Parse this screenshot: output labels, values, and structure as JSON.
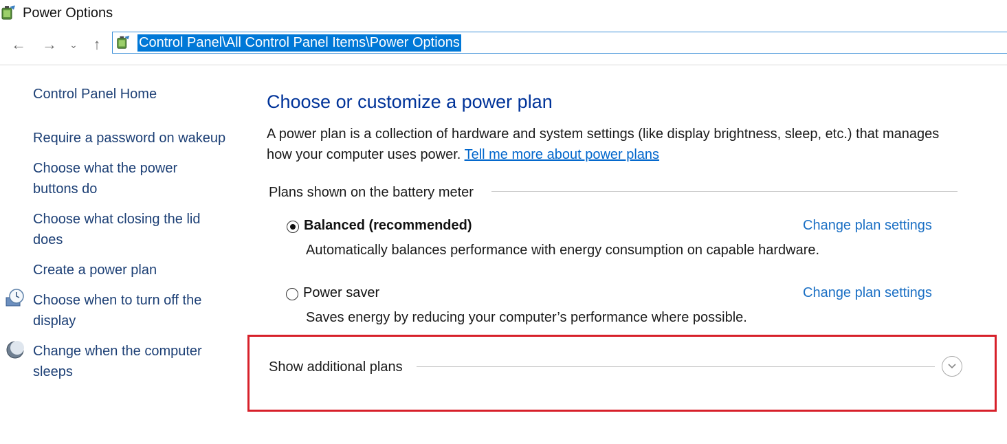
{
  "window": {
    "title": "Power Options"
  },
  "nav": {
    "back_label": "←",
    "forward_label": "→",
    "recent_label": "⌄",
    "up_label": "↑",
    "address": "Control Panel\\All Control Panel Items\\Power Options"
  },
  "sidebar": {
    "home": "Control Panel Home",
    "items": [
      {
        "label": "Require a password on wakeup",
        "icon": ""
      },
      {
        "label": "Choose what the power buttons do",
        "icon": ""
      },
      {
        "label": "Choose what closing the lid does",
        "icon": ""
      },
      {
        "label": "Create a power plan",
        "icon": ""
      },
      {
        "label": "Choose when to turn off the display",
        "icon": "display-clock-icon"
      },
      {
        "label": "Change when the computer sleeps",
        "icon": "moon-icon"
      }
    ]
  },
  "main": {
    "heading": "Choose or customize a power plan",
    "description": "A power plan is a collection of hardware and system settings (like display brightness, sleep, etc.) that manages how your computer uses power.",
    "more_link": "Tell me more about power plans",
    "battery_section_label": "Plans shown on the battery meter",
    "plans": [
      {
        "name": "Balanced (recommended)",
        "description": "Automatically balances performance with energy consumption on capable hardware.",
        "selected": true,
        "change_link": "Change plan settings"
      },
      {
        "name": "Power saver",
        "description": "Saves energy by reducing your computer’s performance where possible.",
        "selected": false,
        "change_link": "Change plan settings"
      }
    ],
    "additional_plans_label": "Show additional plans"
  },
  "colors": {
    "heading": "#003399",
    "link": "#1a6fc4",
    "address_highlight": "#0078d7",
    "annotation_box": "#d7202a"
  }
}
